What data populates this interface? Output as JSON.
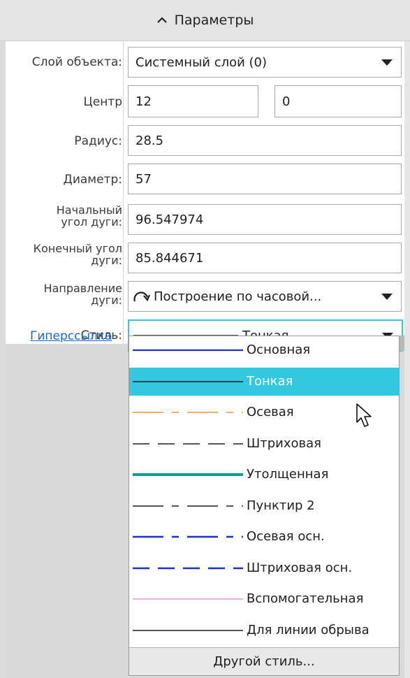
{
  "header": {
    "title": "Параметры"
  },
  "fields": {
    "layer_label": "Слой объекта:",
    "layer_value": "Системный слой (0)",
    "center_label": "Центр",
    "center_x": "12",
    "center_y": "0",
    "radius_label": "Радиус:",
    "radius_value": "28.5",
    "diameter_label": "Диаметр:",
    "diameter_value": "57",
    "start_angle_label_1": "Начальный",
    "start_angle_label_2": "угол дуги:",
    "start_angle_value": "96.547974",
    "end_angle_label_1": "Конечный угол",
    "end_angle_label_2": "дуги:",
    "end_angle_value": "85.844671",
    "direction_label_1": "Направление",
    "direction_label_2": "дуги:",
    "direction_value": "Построение по часовой...",
    "style_label": "Стиль:",
    "style_value": "Тонкая"
  },
  "hyperlink": "Гиперссылка",
  "style_options": [
    {
      "label": "Основная",
      "color": "#1a2fd6",
      "dash": "solid",
      "selected": false
    },
    {
      "label": "Тонкая",
      "color": "#1e1e1e",
      "dash": "solid",
      "selected": true
    },
    {
      "label": "Осевая",
      "color": "#f0952c",
      "dash": "dashdot",
      "selected": false
    },
    {
      "label": "Штриховая",
      "color": "#1e1e1e",
      "dash": "dashed",
      "selected": false
    },
    {
      "label": "Утолщенная",
      "color": "#139a94",
      "dash": "thick",
      "selected": false
    },
    {
      "label": "Пунктир 2",
      "color": "#1e1e1e",
      "dash": "dashdot",
      "selected": false
    },
    {
      "label": "Осевая осн.",
      "color": "#1a2fd6",
      "dash": "dashdot-bold",
      "selected": false
    },
    {
      "label": "Штриховая осн.",
      "color": "#1a2fd6",
      "dash": "dashed-bold",
      "selected": false
    },
    {
      "label": "Вспомогательная",
      "color": "#e39ad0",
      "dash": "solid",
      "selected": false
    },
    {
      "label": "Для линии обрыва",
      "color": "#1e1e1e",
      "dash": "solid",
      "selected": false
    }
  ],
  "other_style_button": "Другой стиль..."
}
